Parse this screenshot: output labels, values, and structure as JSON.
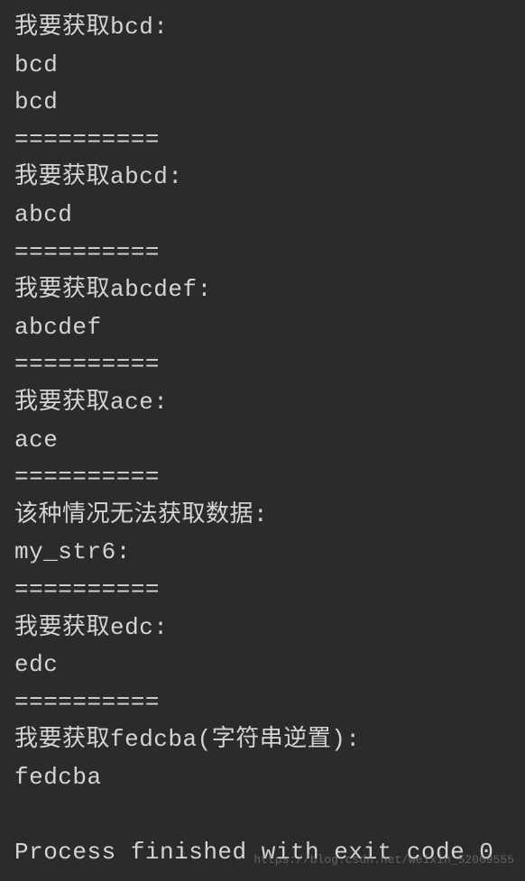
{
  "output": {
    "lines": [
      "我要获取bcd:",
      "bcd",
      "bcd",
      "==========",
      "我要获取abcd:",
      "abcd",
      "==========",
      "我要获取abcdef:",
      "abcdef",
      "==========",
      "我要获取ace:",
      "ace",
      "==========",
      "该种情况无法获取数据:",
      "my_str6:",
      "==========",
      "我要获取edc:",
      "edc",
      "==========",
      "我要获取fedcba(字符串逆置):",
      "fedcba",
      "",
      "Process finished with exit code 0"
    ]
  },
  "watermark": {
    "text": "https://blog.csdn.net/weixin_52009555"
  }
}
